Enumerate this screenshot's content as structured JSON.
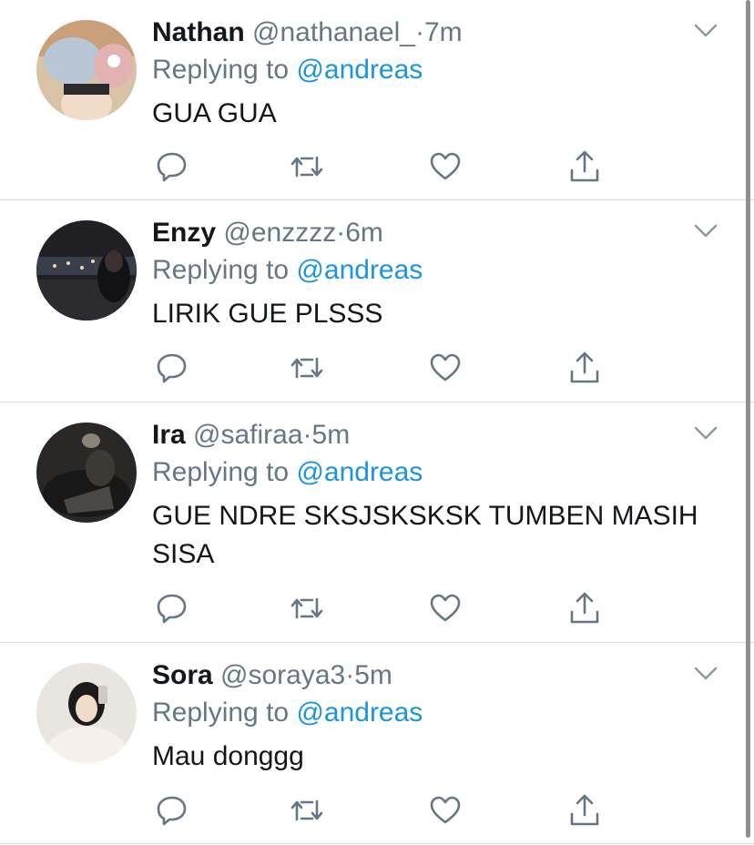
{
  "replies": [
    {
      "name": "Nathan",
      "handle": "@nathanael_",
      "dot": "·",
      "time": "7m",
      "replying_prefix": "Replying to",
      "replying_to": "@andreas",
      "text": "GUA GUA",
      "avatar": "avatar-person-hoodie"
    },
    {
      "name": "Enzy",
      "handle": "@enzzzz",
      "dot": "·",
      "time": "6m",
      "replying_prefix": "Replying to",
      "replying_to": "@andreas",
      "text": "LIRIK GUE PLSSS",
      "avatar": "avatar-night-city"
    },
    {
      "name": "Ira",
      "handle": "@safiraa",
      "dot": "·",
      "time": "5m",
      "replying_prefix": "Replying to",
      "replying_to": "@andreas",
      "text": "GUE NDRE SKSJSKSKSK TUMBEN MASIH SISA",
      "avatar": "avatar-dark-room"
    },
    {
      "name": "Sora",
      "handle": "@soraya3",
      "dot": "·",
      "time": "5m",
      "replying_prefix": "Replying to",
      "replying_to": "@andreas",
      "text": "Mau donggg",
      "avatar": "avatar-mirror-selfie"
    }
  ],
  "icons": {
    "reply": "reply-icon",
    "retweet": "retweet-icon",
    "like": "like-icon",
    "share": "share-icon",
    "menu": "chevron-down-icon"
  },
  "colors": {
    "link": "#1b95e0",
    "secondary_text": "#657786",
    "divider": "#d8dde1"
  }
}
